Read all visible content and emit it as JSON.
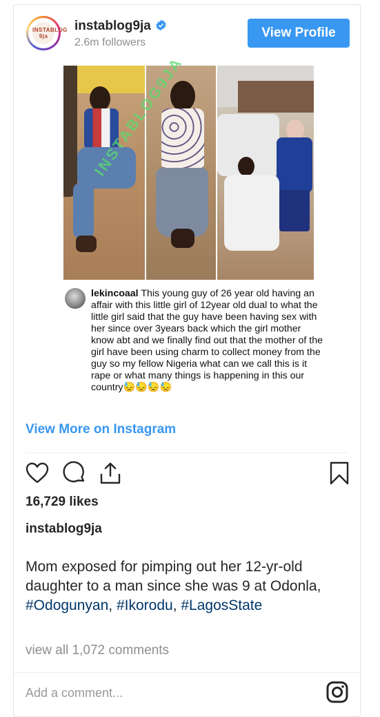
{
  "header": {
    "avatar_text": "INSTABLOG 9ja",
    "username": "instablog9ja",
    "followers": "2.6m followers",
    "view_profile_label": "View Profile",
    "verified_icon": "verified-badge-icon",
    "accent_color": "#3897f0"
  },
  "media": {
    "watermark": "INSTABLOG9JA"
  },
  "embedded_caption": {
    "username": "lekincoaal",
    "text": "This young guy of 26 year old having an affair with this little girl of 12year old dual to what the little girl said that the guy  have been having sex with her since over 3years back which the girl mother know abt and we finally find out that the mother of the girl have been using charm to collect money from the guy so my fellow Nigeria what can we call this is it rape or what many things is happening in this our country😓😓😓😓"
  },
  "view_more": "View More on Instagram",
  "actions": {
    "like_icon": "heart-icon",
    "comment_icon": "comment-icon",
    "share_icon": "share-icon",
    "save_icon": "bookmark-icon"
  },
  "likes": "16,729 likes",
  "author": "instablog9ja",
  "caption": {
    "text": "Mom exposed for pimping out her 12-yr-old daughter to a man since she was 9 at Odonla, ",
    "tag1": "#Odogunyan",
    "sep1": ", ",
    "tag2": "#Ikorodu",
    "sep2": ", ",
    "tag3": "#LagosState"
  },
  "comments_link": "view all 1,072 comments",
  "add_comment_placeholder": "Add a comment...",
  "instagram_icon": "instagram-logo-icon"
}
